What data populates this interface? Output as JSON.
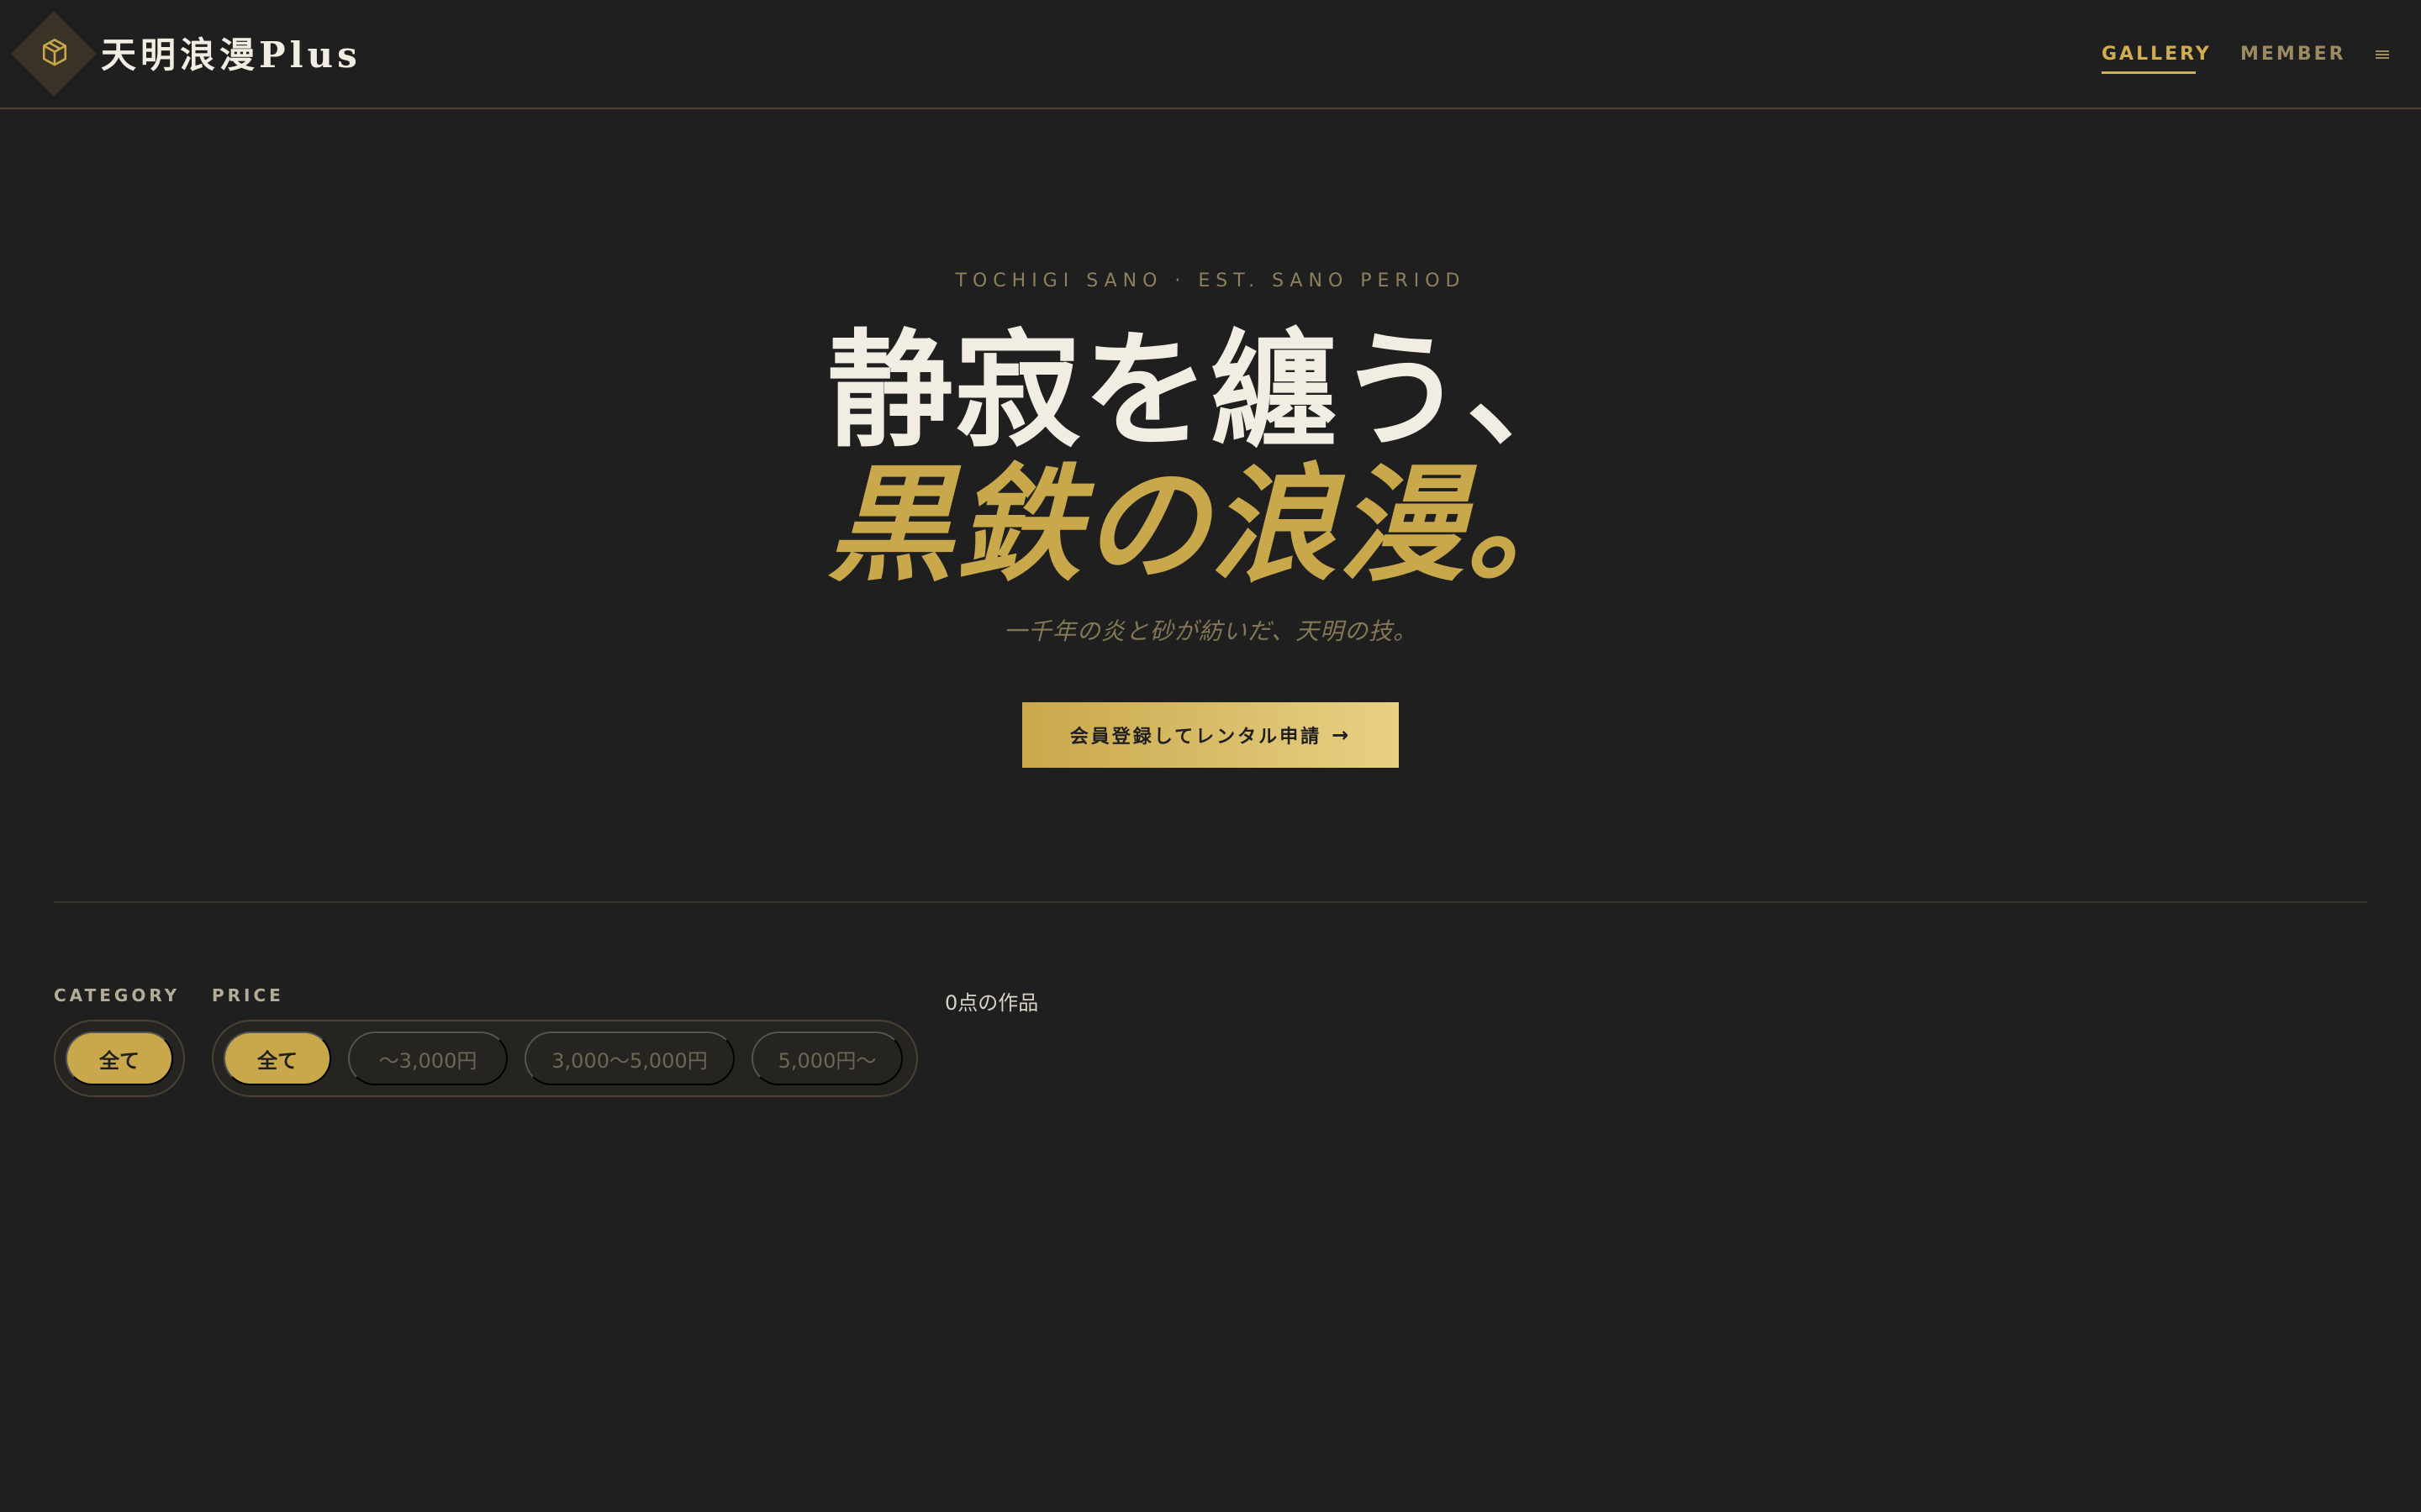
{
  "header": {
    "brand": "天明浪漫Plus",
    "logo_icon": "box-icon",
    "nav": [
      {
        "label": "GALLERY",
        "active": true
      },
      {
        "label": "MEMBER",
        "active": false
      }
    ],
    "menu_icon": "hamburger-menu-icon"
  },
  "hero": {
    "eyebrow": "TOCHIGI SANO · EST. SANO PERIOD",
    "title_line1": "静寂を纏う、",
    "title_line2": "黒鉄の浪漫。",
    "subtitle": "一千年の炎と砂が紡いだ、天明の技。",
    "cta_label": "会員登録してレンタル申請",
    "cta_arrow": "→"
  },
  "filters": {
    "category": {
      "label": "CATEGORY",
      "options": [
        {
          "label": "全て",
          "active": true
        }
      ]
    },
    "price": {
      "label": "PRICE",
      "options": [
        {
          "label": "全て",
          "active": true
        },
        {
          "label": "〜3,000円",
          "active": false
        },
        {
          "label": "3,000〜5,000円",
          "active": false
        },
        {
          "label": "5,000円〜",
          "active": false
        }
      ]
    }
  },
  "results": {
    "count_text": "0点の作品"
  },
  "colors": {
    "background": "#1f1f1f",
    "accent_gold": "#c9a84c",
    "text_light": "#f2ede2",
    "muted_gold": "#9c8a62"
  }
}
